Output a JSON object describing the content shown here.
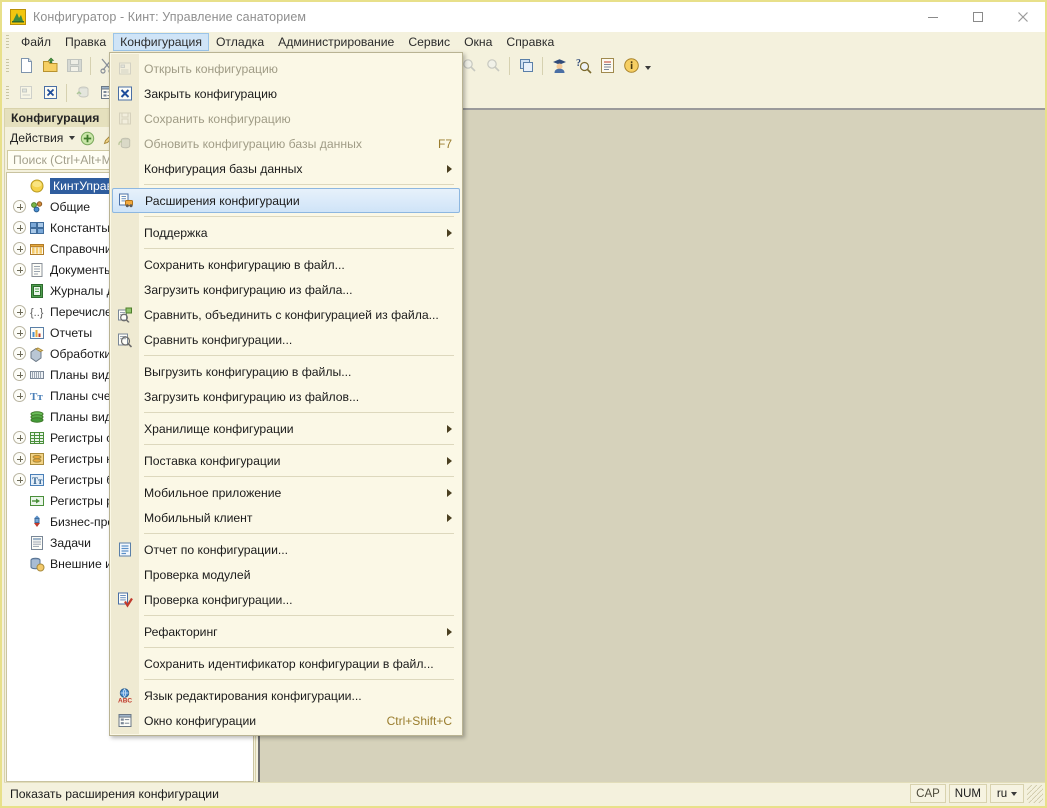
{
  "window": {
    "title": "Конфигуратор - Кинт: Управление санаторием",
    "app_icon": "1c-configurator-icon",
    "minimize_label": "—",
    "maximize_label": "□",
    "close_label": "✕"
  },
  "menubar": {
    "items": [
      {
        "label": "Файл",
        "accel": "Ф",
        "active": false
      },
      {
        "label": "Правка",
        "accel": "П",
        "active": false
      },
      {
        "label": "Конфигурация",
        "accel": "К",
        "active": true
      },
      {
        "label": "Отладка",
        "accel": "О",
        "active": false
      },
      {
        "label": "Администрирование",
        "accel": "А",
        "active": false
      },
      {
        "label": "Сервис",
        "accel": "С",
        "active": false
      },
      {
        "label": "Окна",
        "accel": "О",
        "active": false
      },
      {
        "label": "Справка",
        "accel": "п",
        "active": false
      }
    ]
  },
  "toolbar_row1": {
    "buttons": [
      {
        "name": "new-file-icon",
        "disabled": false
      },
      {
        "name": "open-file-icon",
        "disabled": false
      },
      {
        "name": "save-icon",
        "disabled": true
      },
      {
        "name": "cut-icon",
        "disabled": false
      }
    ],
    "right_buttons": [
      {
        "name": "find-previous-icon",
        "disabled": true
      },
      {
        "name": "find-next-icon",
        "disabled": true
      },
      {
        "name": "windows-icon",
        "disabled": false
      },
      {
        "name": "user-icon",
        "disabled": false
      },
      {
        "name": "help-search-icon",
        "disabled": false
      },
      {
        "name": "syntax-assistant-icon",
        "disabled": false
      },
      {
        "name": "about-info-icon",
        "disabled": false
      }
    ]
  },
  "toolbar_row2": {
    "buttons": [
      {
        "name": "open-configuration-icon",
        "disabled": true
      },
      {
        "name": "close-configuration-icon",
        "disabled": false
      },
      {
        "name": "update-database-configuration-icon",
        "disabled": true
      },
      {
        "name": "configuration-window-icon",
        "disabled": false
      }
    ]
  },
  "sidebar": {
    "caption": "Конфигурация",
    "actions_label": "Действия",
    "action_buttons": [
      {
        "name": "add-icon"
      },
      {
        "name": "edit-icon"
      }
    ],
    "search_placeholder": "Поиск (Ctrl+Alt+M)",
    "tree": [
      {
        "label": "КинтУправлени",
        "icon": "config-root-icon",
        "expander": "none",
        "selected": true
      },
      {
        "label": "Общие",
        "icon": "common-icon",
        "expander": "plus",
        "selected": false
      },
      {
        "label": "Константы",
        "icon": "constants-icon",
        "expander": "plus",
        "selected": false
      },
      {
        "label": "Справочник",
        "icon": "catalogs-icon",
        "expander": "plus",
        "selected": false
      },
      {
        "label": "Документы",
        "icon": "documents-icon",
        "expander": "plus",
        "selected": false
      },
      {
        "label": "Журналы до",
        "icon": "document-journals-icon",
        "expander": "none",
        "selected": false
      },
      {
        "label": "Перечислен",
        "icon": "enums-icon",
        "expander": "plus",
        "selected": false
      },
      {
        "label": "Отчеты",
        "icon": "reports-icon",
        "expander": "plus",
        "selected": false
      },
      {
        "label": "Обработки",
        "icon": "data-processors-icon",
        "expander": "plus",
        "selected": false
      },
      {
        "label": "Планы видо",
        "icon": "chart-of-characteristic-types-icon",
        "expander": "plus",
        "selected": false
      },
      {
        "label": "Планы счет",
        "icon": "chart-of-accounts-icon",
        "expander": "plus",
        "selected": false
      },
      {
        "label": "Планы видо",
        "icon": "chart-of-calculation-types-icon",
        "expander": "none",
        "selected": false
      },
      {
        "label": "Регистры св",
        "icon": "information-registers-icon",
        "expander": "plus",
        "selected": false
      },
      {
        "label": "Регистры на",
        "icon": "accumulation-registers-icon",
        "expander": "plus",
        "selected": false
      },
      {
        "label": "Регистры бу",
        "icon": "accounting-registers-icon",
        "expander": "plus",
        "selected": false
      },
      {
        "label": "Регистры ра",
        "icon": "calculation-registers-icon",
        "expander": "none",
        "selected": false
      },
      {
        "label": "Бизнес-проц",
        "icon": "business-processes-icon",
        "expander": "none",
        "selected": false
      },
      {
        "label": "Задачи",
        "icon": "tasks-icon",
        "expander": "none",
        "selected": false
      },
      {
        "label": "Внешние ис",
        "icon": "external-data-sources-icon",
        "expander": "none",
        "selected": false
      }
    ]
  },
  "dropdown": {
    "name": "configuration-menu",
    "items": [
      {
        "type": "item",
        "label": "Открыть конфигурацию",
        "icon": "open-configuration-icon",
        "disabled": true,
        "shortcut": "",
        "submenu": false,
        "highlighted": false
      },
      {
        "type": "item",
        "label": "Закрыть конфигурацию",
        "icon": "close-configuration-icon",
        "disabled": false,
        "shortcut": "",
        "submenu": false,
        "highlighted": false
      },
      {
        "type": "item",
        "label": "Сохранить конфигурацию",
        "icon": "save-configuration-icon",
        "disabled": true,
        "shortcut": "",
        "submenu": false,
        "highlighted": false
      },
      {
        "type": "item",
        "label": "Обновить конфигурацию базы данных",
        "icon": "update-database-configuration-icon",
        "disabled": true,
        "shortcut": "F7",
        "submenu": false,
        "highlighted": false
      },
      {
        "type": "item",
        "label": "Конфигурация базы данных",
        "icon": "",
        "disabled": false,
        "shortcut": "",
        "submenu": true,
        "highlighted": false
      },
      {
        "type": "separator"
      },
      {
        "type": "item",
        "label": "Расширения конфигурации",
        "icon": "configuration-extensions-icon",
        "disabled": false,
        "shortcut": "",
        "submenu": false,
        "highlighted": true
      },
      {
        "type": "separator"
      },
      {
        "type": "item",
        "label": "Поддержка",
        "icon": "",
        "disabled": false,
        "shortcut": "",
        "submenu": true,
        "highlighted": false
      },
      {
        "type": "separator"
      },
      {
        "type": "item",
        "label": "Сохранить конфигурацию в файл...",
        "icon": "",
        "disabled": false,
        "shortcut": "",
        "submenu": false,
        "highlighted": false
      },
      {
        "type": "item",
        "label": "Загрузить конфигурацию из файла...",
        "icon": "",
        "disabled": false,
        "shortcut": "",
        "submenu": false,
        "highlighted": false
      },
      {
        "type": "item",
        "label": "Сравнить, объединить с конфигурацией из файла...",
        "icon": "compare-merge-icon",
        "disabled": false,
        "shortcut": "",
        "submenu": false,
        "highlighted": false
      },
      {
        "type": "item",
        "label": "Сравнить конфигурации...",
        "icon": "compare-configurations-icon",
        "disabled": false,
        "shortcut": "",
        "submenu": false,
        "highlighted": false
      },
      {
        "type": "separator"
      },
      {
        "type": "item",
        "label": "Выгрузить конфигурацию в файлы...",
        "icon": "",
        "disabled": false,
        "shortcut": "",
        "submenu": false,
        "highlighted": false
      },
      {
        "type": "item",
        "label": "Загрузить конфигурацию из файлов...",
        "icon": "",
        "disabled": false,
        "shortcut": "",
        "submenu": false,
        "highlighted": false
      },
      {
        "type": "separator"
      },
      {
        "type": "item",
        "label": "Хранилище конфигурации",
        "icon": "",
        "disabled": false,
        "shortcut": "",
        "submenu": true,
        "highlighted": false
      },
      {
        "type": "separator"
      },
      {
        "type": "item",
        "label": "Поставка конфигурации",
        "icon": "",
        "disabled": false,
        "shortcut": "",
        "submenu": true,
        "highlighted": false
      },
      {
        "type": "separator"
      },
      {
        "type": "item",
        "label": "Мобильное приложение",
        "icon": "",
        "disabled": false,
        "shortcut": "",
        "submenu": true,
        "highlighted": false
      },
      {
        "type": "item",
        "label": "Мобильный клиент",
        "icon": "",
        "disabled": false,
        "shortcut": "",
        "submenu": true,
        "highlighted": false
      },
      {
        "type": "separator"
      },
      {
        "type": "item",
        "label": "Отчет по конфигурации...",
        "icon": "configuration-report-icon",
        "disabled": false,
        "shortcut": "",
        "submenu": false,
        "highlighted": false
      },
      {
        "type": "item",
        "label": "Проверка модулей",
        "icon": "",
        "disabled": false,
        "shortcut": "",
        "submenu": false,
        "highlighted": false
      },
      {
        "type": "item",
        "label": "Проверка конфигурации...",
        "icon": "check-configuration-icon",
        "disabled": false,
        "shortcut": "",
        "submenu": false,
        "highlighted": false
      },
      {
        "type": "separator"
      },
      {
        "type": "item",
        "label": "Рефакторинг",
        "icon": "",
        "disabled": false,
        "shortcut": "",
        "submenu": true,
        "highlighted": false
      },
      {
        "type": "separator"
      },
      {
        "type": "item",
        "label": "Сохранить идентификатор конфигурации в файл...",
        "icon": "",
        "disabled": false,
        "shortcut": "",
        "submenu": false,
        "highlighted": false
      },
      {
        "type": "separator"
      },
      {
        "type": "item",
        "label": "Язык редактирования конфигурации...",
        "icon": "editing-language-icon",
        "disabled": false,
        "shortcut": "",
        "submenu": false,
        "highlighted": false
      },
      {
        "type": "item",
        "label": "Окно конфигурации",
        "icon": "configuration-window-icon",
        "disabled": false,
        "shortcut": "Ctrl+Shift+C",
        "submenu": false,
        "highlighted": false
      }
    ]
  },
  "statusbar": {
    "message": "Показать расширения конфигурации",
    "indicators": [
      {
        "label": "CAP",
        "active": false
      },
      {
        "label": "NUM",
        "active": true
      },
      {
        "label": "ru",
        "active": true,
        "dropdown": true
      }
    ]
  },
  "colors": {
    "chrome": "#f4f1dd",
    "menu_bg": "#fbf8e6",
    "highlight_blue": "#cfe4f8",
    "highlight_border": "#8db7e0",
    "selection_blue": "#2f5d9e",
    "mdi_bg": "#d6d2bb",
    "shortcut_text": "#9a7d2e",
    "disabled_text": "#a09c86",
    "window_border": "#e8e08a"
  }
}
